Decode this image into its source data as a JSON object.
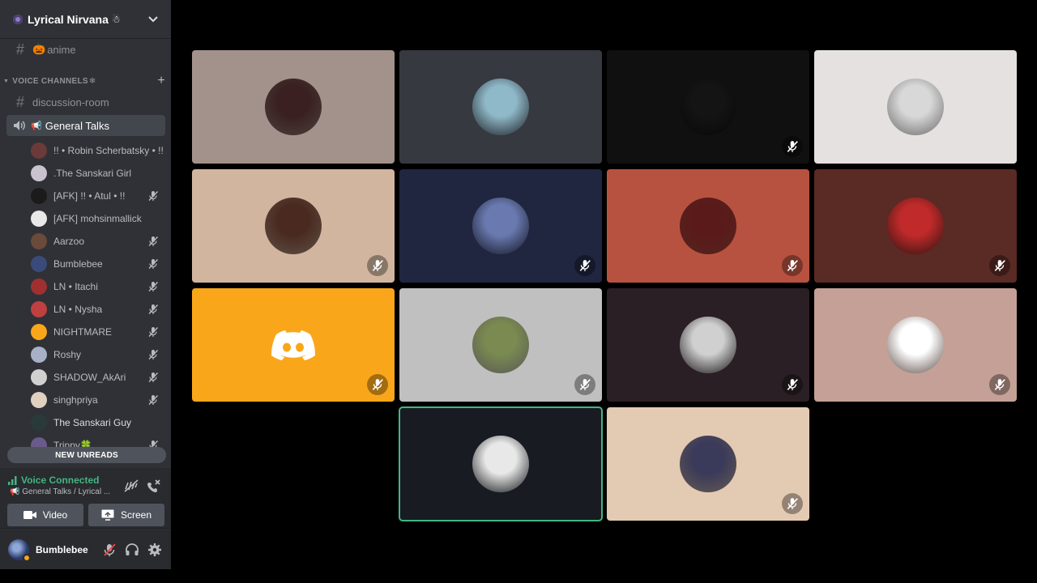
{
  "server": {
    "name": "Lyrical Nirvana",
    "emoji": "☃"
  },
  "text_channels": [
    {
      "label": "anime",
      "emoji": "🎃"
    }
  ],
  "category": {
    "label": "VOICE CHANNELS",
    "emoji": "❄"
  },
  "discussion_room": {
    "label": "discussion-room"
  },
  "voice_channel": {
    "label": "General Talks",
    "emoji": "📢"
  },
  "voice_users": [
    {
      "name": "!! • Robin Scherbatsky • !!",
      "color": "#6b3a3a",
      "muted": false
    },
    {
      "name": ".The Sanskari Girl",
      "color": "#c9c3cf",
      "muted": false
    },
    {
      "name": "[AFK] !! • Atul • !!",
      "color": "#1b1b1b",
      "muted": true
    },
    {
      "name": "[AFK] mohsinmallick",
      "color": "#e8e8e8",
      "muted": false
    },
    {
      "name": "Aarzoo",
      "color": "#6a4a3a",
      "muted": true
    },
    {
      "name": "Bumblebee",
      "color": "#3a4a7a",
      "muted": true
    },
    {
      "name": "LN • Itachi",
      "color": "#a03030",
      "muted": true
    },
    {
      "name": "LN • Nysha",
      "color": "#c04040",
      "muted": true
    },
    {
      "name": "NIGHTMARE",
      "color": "#faa61a",
      "muted": true
    },
    {
      "name": "Roshy",
      "color": "#a8b0c8",
      "muted": true
    },
    {
      "name": "SHADOW_AkAri",
      "color": "#d0d0d0",
      "muted": true
    },
    {
      "name": "singhpriya",
      "color": "#e0d0c0",
      "muted": true
    },
    {
      "name": "The Sanskari Guy",
      "color": "#2a3a3a",
      "muted": false,
      "bright": true
    },
    {
      "name": "Trippy🍀",
      "color": "#6a5a8a",
      "muted": true
    }
  ],
  "new_unreads": "NEW UNREADS",
  "voice_panel": {
    "status": "Voice Connected",
    "subtitle": "📢 General Talks / Lyrical ...",
    "video_label": "Video",
    "screen_label": "Screen"
  },
  "user_panel": {
    "name": "Bumblebee"
  },
  "tiles": [
    {
      "bg": "#a3928b",
      "avatar": "#3a2020",
      "muted": false
    },
    {
      "bg": "#36393f",
      "avatar": "#8fb8c8",
      "muted": false
    },
    {
      "bg": "#101010",
      "avatar": "#141414",
      "muted": true
    },
    {
      "bg": "#e5e1e1",
      "avatar": "#d8d8d8",
      "muted": false
    },
    {
      "bg": "#d2b59f",
      "avatar": "#4a2a20",
      "muted": true
    },
    {
      "bg": "#202640",
      "avatar": "#6a7ab0",
      "muted": true
    },
    {
      "bg": "#b85240",
      "avatar": "#5a1a1a",
      "muted": true
    },
    {
      "bg": "#5a2a24",
      "avatar": "#c02a2a",
      "muted": true
    },
    {
      "bg": "#faa61a",
      "avatar": "#faa61a",
      "muted": true,
      "discord": true
    },
    {
      "bg": "#c0c0c0",
      "avatar": "#7a8a50",
      "muted": true
    },
    {
      "bg": "#2a1f24",
      "avatar": "#d0d0d0",
      "muted": true
    },
    {
      "bg": "#c4a096",
      "avatar": "#ffffff",
      "muted": true
    },
    {
      "bg": "#181c22",
      "avatar": "#e8e8e8",
      "muted": false,
      "active": true
    },
    {
      "bg": "#e3cab2",
      "avatar": "#3a3a5a",
      "muted": true
    }
  ]
}
